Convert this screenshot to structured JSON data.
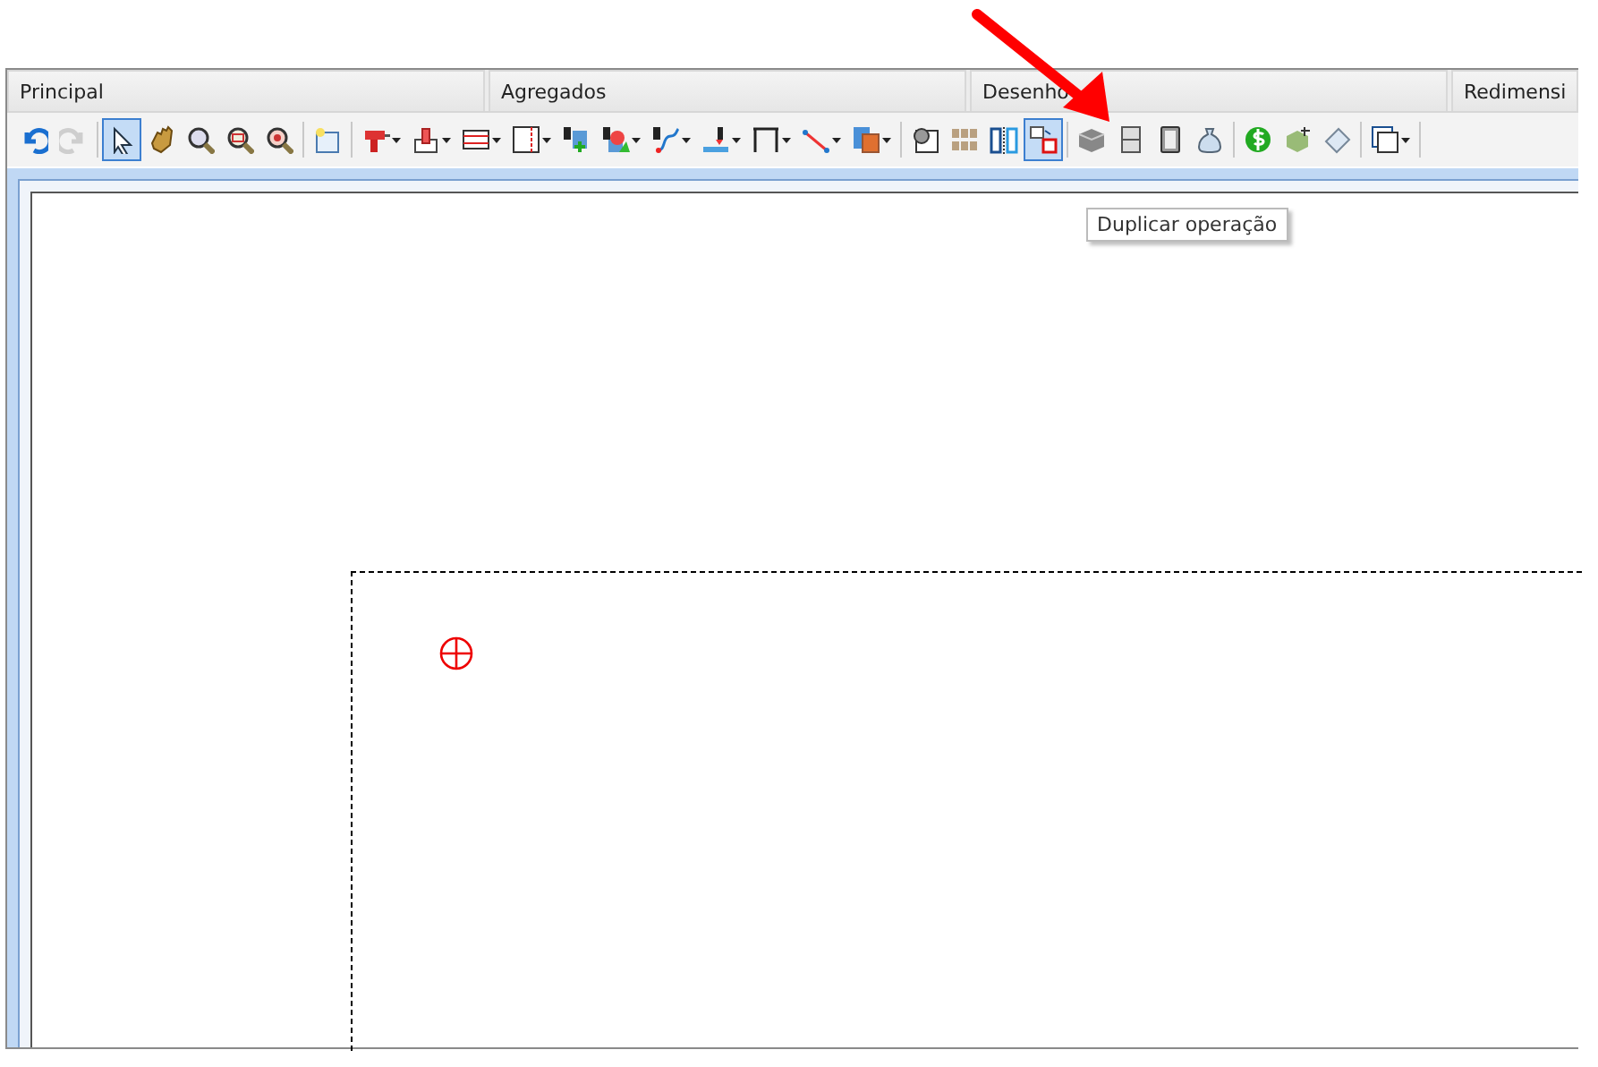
{
  "tabs": [
    {
      "label": "Principal"
    },
    {
      "label": "Agregados"
    },
    {
      "label": "Desenho"
    },
    {
      "label": "Redimensi"
    }
  ],
  "toolbar": [
    {
      "kind": "button",
      "disabled": false,
      "selected": false,
      "dropdown": false
    },
    {
      "kind": "button",
      "disabled": true,
      "selected": false,
      "dropdown": false
    },
    {
      "kind": "separator"
    },
    {
      "kind": "button",
      "disabled": false,
      "selected": true,
      "dropdown": false
    },
    {
      "kind": "button",
      "disabled": false,
      "selected": false,
      "dropdown": false
    },
    {
      "kind": "button",
      "disabled": false,
      "selected": false,
      "dropdown": false
    },
    {
      "kind": "button",
      "disabled": false,
      "selected": false,
      "dropdown": false
    },
    {
      "kind": "button",
      "disabled": false,
      "selected": false,
      "dropdown": false
    },
    {
      "kind": "separator"
    },
    {
      "kind": "button",
      "disabled": false,
      "selected": false,
      "dropdown": false
    },
    {
      "kind": "separator"
    },
    {
      "kind": "button",
      "disabled": false,
      "selected": false,
      "dropdown": true
    },
    {
      "kind": "button",
      "disabled": false,
      "selected": false,
      "dropdown": true
    },
    {
      "kind": "button",
      "disabled": false,
      "selected": false,
      "dropdown": true
    },
    {
      "kind": "button",
      "disabled": false,
      "selected": false,
      "dropdown": true
    },
    {
      "kind": "button",
      "disabled": false,
      "selected": false,
      "dropdown": false
    },
    {
      "kind": "button",
      "disabled": false,
      "selected": false,
      "dropdown": true
    },
    {
      "kind": "button",
      "disabled": false,
      "selected": false,
      "dropdown": true
    },
    {
      "kind": "button",
      "disabled": false,
      "selected": false,
      "dropdown": true
    },
    {
      "kind": "button",
      "disabled": false,
      "selected": false,
      "dropdown": true
    },
    {
      "kind": "button",
      "disabled": false,
      "selected": false,
      "dropdown": true
    },
    {
      "kind": "button",
      "disabled": false,
      "selected": false,
      "dropdown": true
    },
    {
      "kind": "separator"
    },
    {
      "kind": "button",
      "disabled": false,
      "selected": false,
      "dropdown": false
    },
    {
      "kind": "button",
      "disabled": false,
      "selected": false,
      "dropdown": false
    },
    {
      "kind": "button",
      "disabled": false,
      "selected": false,
      "dropdown": false
    },
    {
      "kind": "button",
      "disabled": false,
      "selected": true,
      "dropdown": false
    },
    {
      "kind": "separator"
    },
    {
      "kind": "button",
      "disabled": false,
      "selected": false,
      "dropdown": false
    },
    {
      "kind": "button",
      "disabled": false,
      "selected": false,
      "dropdown": false
    },
    {
      "kind": "button",
      "disabled": false,
      "selected": false,
      "dropdown": false
    },
    {
      "kind": "button",
      "disabled": false,
      "selected": false,
      "dropdown": false
    },
    {
      "kind": "separator"
    },
    {
      "kind": "button",
      "disabled": false,
      "selected": false,
      "dropdown": false
    },
    {
      "kind": "button",
      "disabled": false,
      "selected": false,
      "dropdown": false
    },
    {
      "kind": "button",
      "disabled": false,
      "selected": false,
      "dropdown": false
    },
    {
      "kind": "separator"
    },
    {
      "kind": "button",
      "disabled": false,
      "selected": false,
      "dropdown": true
    },
    {
      "kind": "separator"
    }
  ],
  "tooltip": {
    "text": "Duplicar operação"
  }
}
